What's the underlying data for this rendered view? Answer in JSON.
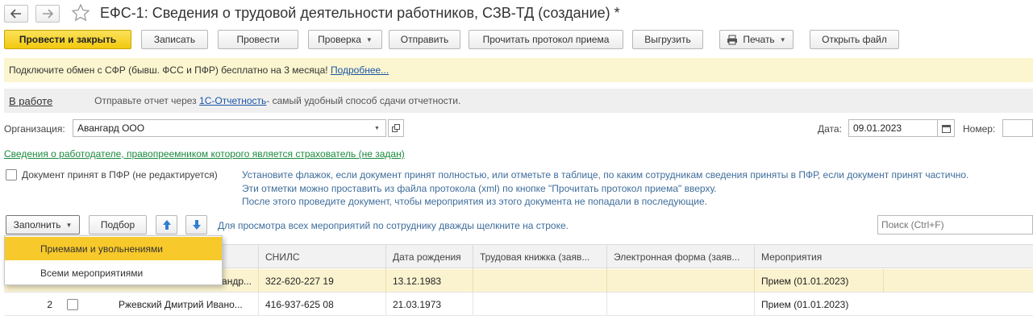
{
  "window": {
    "title": "ЕФС-1: Сведения о трудовой деятельности работников, СЗВ-ТД (создание) *",
    "back_icon": "arrow-left-icon",
    "forward_icon": "arrow-right-icon",
    "star_icon": "star-icon"
  },
  "toolbar": {
    "post_close": "Провести и закрыть",
    "save": "Записать",
    "post": "Провести",
    "check": "Проверка",
    "send": "Отправить",
    "read_protocol": "Прочитать протокол приема",
    "export": "Выгрузить",
    "print": "Печать",
    "open_file": "Открыть файл"
  },
  "banner": {
    "text": "Подключите обмен с СФР (бывш. ФСС и ПФР) бесплатно на 3 месяца!",
    "link": "Подробнее..."
  },
  "status": {
    "state": "В работе",
    "send_prefix": "Отправьте отчет через",
    "send_link": "1С-Отчетность",
    "send_suffix": " - самый удобный способ сдачи отчетности."
  },
  "form": {
    "org_label": "Организация:",
    "org_value": "Авангард ООО",
    "date_label": "Дата:",
    "date_value": "09.01.2023",
    "number_label": "Номер:",
    "number_value": "",
    "employer_link": "Сведения о работодателе, правопреемником которого является страхователь (не задан)",
    "accepted_label": "Документ принят в ПФР (не редактируется)",
    "hint_line1": "Установите флажок, если документ принят полностью, или отметьте в таблице, по каким сотрудникам сведения приняты в ПФР, если документ принят частично.",
    "hint_line2": "Эти отметки можно проставить из файла протокола (xml) по кнопке \"Прочитать протокол приема\" вверху.",
    "hint_line3": "После этого проведите документ, чтобы мероприятия из этого документа не попадали в последующие."
  },
  "table_toolbar": {
    "fill": "Заполнить",
    "select": "Подбор",
    "hint": "Для просмотра всех мероприятий по сотруднику дважды щелкните на строке.",
    "search_placeholder": "Поиск (Ctrl+F)"
  },
  "popup": {
    "items": [
      "Приемами и увольнениями",
      "Всеми мероприятиями"
    ]
  },
  "table": {
    "columns": [
      "СНИЛС",
      "Дата рождения",
      "Трудовая книжка (заяв...",
      "Электронная форма (заяв...",
      "Мероприятия"
    ],
    "rows": [
      {
        "num": "",
        "name": "...андр...",
        "snils": "322-620-227 19",
        "birth": "13.12.1983",
        "book": "",
        "eform": "",
        "events": "Прием (01.01.2023)"
      },
      {
        "num": "2",
        "name": "Ржевский Дмитрий Ивано...",
        "snils": "416-937-625 08",
        "birth": "21.03.1973",
        "book": "",
        "eform": "",
        "events": "Прием (01.01.2023)"
      }
    ]
  },
  "colors": {
    "primary_button": "#f2c90f",
    "banner_bg": "#fbf6cf",
    "selected_row": "#fbf3cf",
    "popup_highlight": "#f7c92a",
    "link": "#1b55a8",
    "green_link": "#1b8a3d"
  }
}
